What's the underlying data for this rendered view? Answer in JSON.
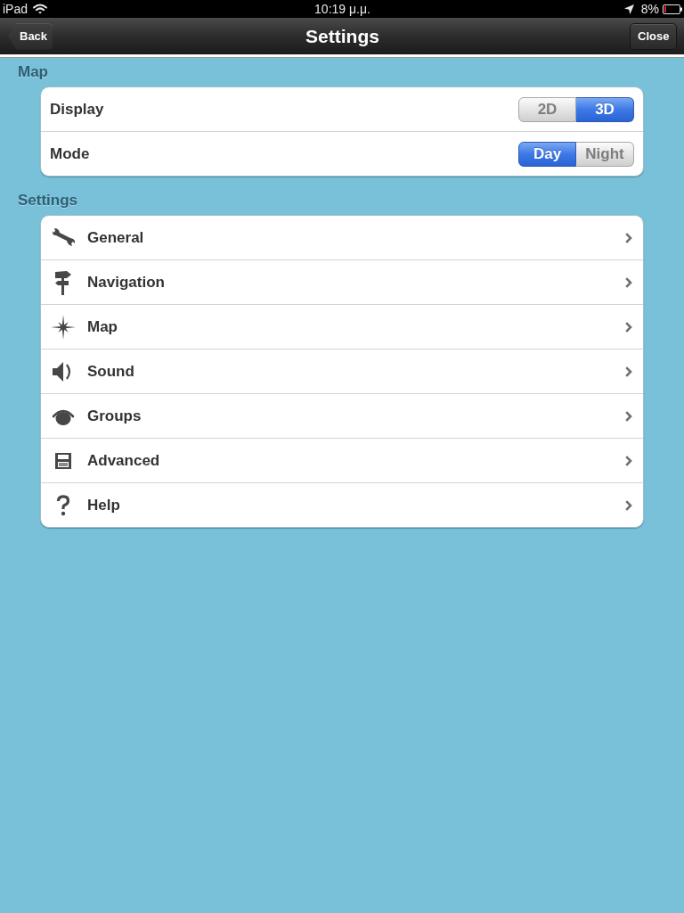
{
  "status_bar": {
    "carrier": "iPad",
    "time": "10:19 μ.μ.",
    "battery_text": "8%"
  },
  "nav_bar": {
    "back_button": "Back",
    "title": "Settings",
    "close_button": "Close"
  },
  "sections": [
    {
      "header": "Map",
      "rows": [
        {
          "kind": "segmented",
          "label": "Display",
          "options": [
            {
              "label": "2D",
              "selected": false
            },
            {
              "label": "3D",
              "selected": true
            }
          ]
        },
        {
          "kind": "segmented",
          "label": "Mode",
          "options": [
            {
              "label": "Day",
              "selected": true
            },
            {
              "label": "Night",
              "selected": false
            }
          ]
        }
      ]
    },
    {
      "header": "Settings",
      "rows": [
        {
          "kind": "disclosure",
          "label": "General"
        },
        {
          "kind": "disclosure",
          "label": "Navigation"
        },
        {
          "kind": "disclosure",
          "label": "Map"
        },
        {
          "kind": "disclosure",
          "label": "Sound"
        },
        {
          "kind": "disclosure",
          "label": "Groups"
        },
        {
          "kind": "disclosure",
          "label": "Advanced"
        },
        {
          "kind": "disclosure",
          "label": "Help"
        }
      ]
    }
  ]
}
